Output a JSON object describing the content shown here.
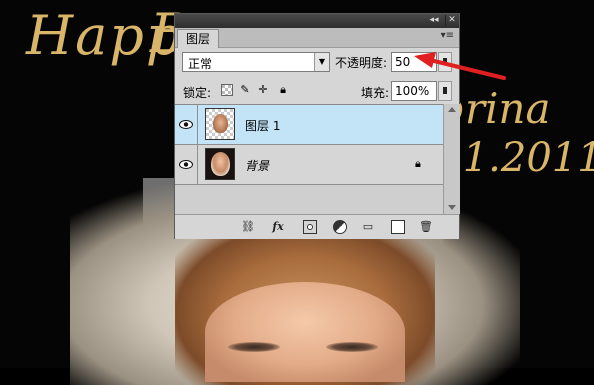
{
  "background": {
    "script_texts": {
      "happy": "Happy",
      "bday": "B",
      "sabrina": "brina",
      "date": ".1.2011"
    }
  },
  "panel": {
    "tab_label": "图层",
    "blend_mode": "正常",
    "opacity_label": "不透明度:",
    "opacity_value": "50",
    "lock_label": "锁定:",
    "fill_label": "填充:",
    "fill_value": "100%",
    "layers": [
      {
        "name": "图层 1",
        "selected": true,
        "visible": true
      },
      {
        "name": "背景",
        "selected": false,
        "visible": true,
        "locked": true
      }
    ],
    "bottom_icons": [
      "link-icon",
      "fx-icon",
      "mask-icon",
      "adjustment-icon",
      "folder-icon",
      "new-layer-icon",
      "trash-icon"
    ]
  },
  "colors": {
    "selected_layer": "#c2e4f6",
    "panel_bg": "#d6d6d6",
    "arrow": "#e02020",
    "script_gold": "#d9b56a"
  }
}
